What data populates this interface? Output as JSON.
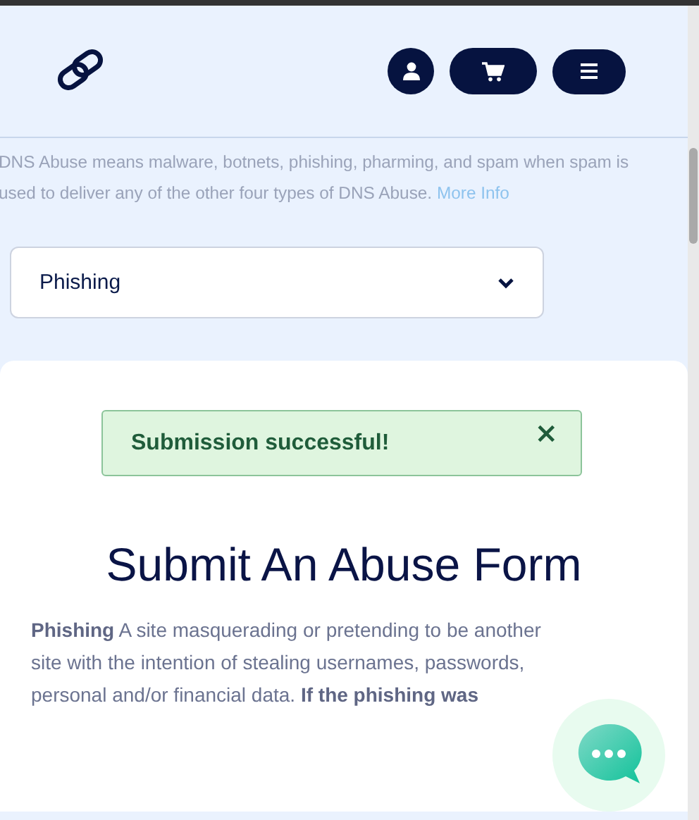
{
  "intro": {
    "text": "DNS Abuse means malware, botnets, phishing, pharming, and spam when spam is used to deliver any of the other four types of DNS Abuse.",
    "link": "More Info"
  },
  "abuse_type": {
    "value": "Phishing"
  },
  "alert": {
    "message": "Submission successful!",
    "close": "×"
  },
  "form": {
    "title": "Submit An Abuse Form",
    "description": "**Phishing** A site masquerading or pretending to be another site with the intention of stealing usernames, passwords, personal and/or financial data. **If the phishing was**"
  }
}
